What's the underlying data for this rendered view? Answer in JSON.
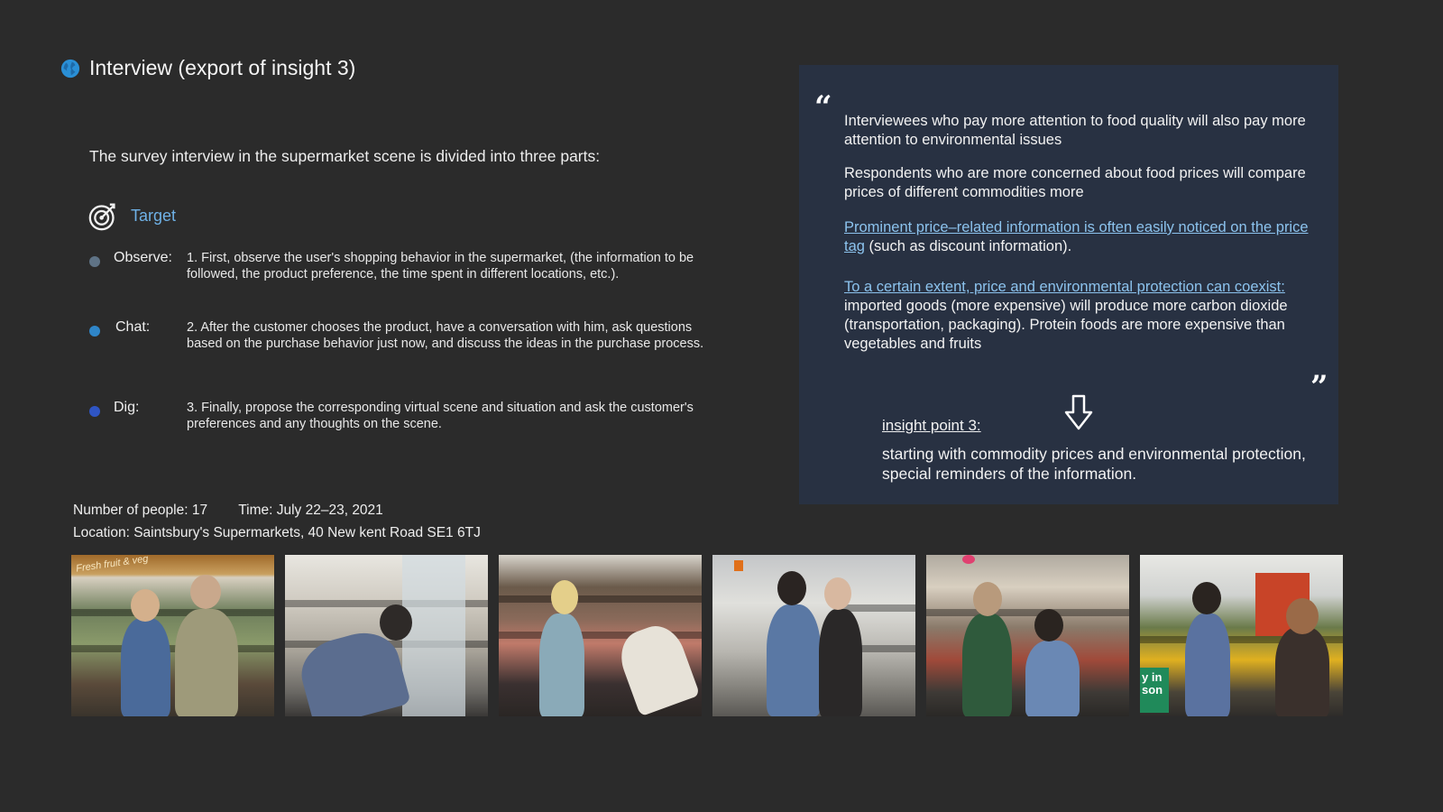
{
  "title": "Interview (export of insight 3)",
  "intro": "The survey interview in the supermarket scene is divided into three parts:",
  "target_label": "Target",
  "steps": [
    {
      "label": "Observe:",
      "text": "1. First, observe the user's shopping behavior in the supermarket, (the information to be followed, the product preference, the time spent in different locations, etc.).",
      "color": "#5f7386"
    },
    {
      "label": "Chat:",
      "text": "2. After the customer chooses the product, have a conversation with him, ask questions based on the purchase behavior just now, and discuss the ideas in the purchase process.",
      "color": "#2f86c9"
    },
    {
      "label": "Dig:",
      "text": "3. Finally, propose the corresponding virtual scene and situation and ask the customer's preferences and any thoughts on the scene.",
      "color": "#2f55c4"
    }
  ],
  "meta": {
    "people": "Number of people: 17",
    "time": "Time: July 22–23, 2021",
    "location": "Location: Saintsbury's Supermarkets, 40 New kent Road SE1 6TJ"
  },
  "quote": {
    "open_mark": "“",
    "close_mark": "”",
    "p1": "Interviewees who pay more attention to food quality will also pay more attention to environmental issues",
    "p2": "Respondents who are more concerned about food prices will compare prices of different commodities more",
    "p3_link": "Prominent price–related information is often easily noticed on the price tag",
    "p3_rest": " (such as discount information).",
    "p4_link": "To a certain extent, price and environmental protection can coexist: ",
    "p4_rest": "imported goods (more expensive) will produce more carbon dioxide (transportation, packaging). Protein foods are more expensive than vegetables and fruits"
  },
  "insight": {
    "title": "insight point 3:",
    "body": "starting with commodity prices and environmental protection, special reminders of the information."
  },
  "photos": {
    "count": 6,
    "sign_text": "Fresh fruit & veg",
    "sign_text_last": "y in son"
  }
}
